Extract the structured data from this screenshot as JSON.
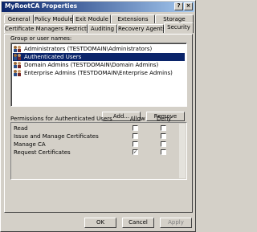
{
  "window": {
    "title": "MyRootCA Properties"
  },
  "tabs_row1": [
    "General",
    "Policy Module",
    "Exit Module",
    "Extensions",
    "Storage"
  ],
  "tabs_row2": [
    "Certificate Managers Restrictions",
    "Auditing",
    "Recovery Agents",
    "Security"
  ],
  "active_tab": "Security",
  "security": {
    "group_label": "Group or user names:",
    "users": [
      "Administrators (TESTDOMAIN\\Administrators)",
      "Authenticated Users",
      "Domain Admins (TESTDOMAIN\\Domain Admins)",
      "Enterprise Admins (TESTDOMAIN\\Enterprise Admins)"
    ],
    "selected_user": "Authenticated Users",
    "add_label": "Add...",
    "remove_label": "Remove",
    "permissions_label": "Permissions for Authenticated Users",
    "allow_label": "Allow",
    "deny_label": "Deny",
    "permissions": [
      {
        "name": "Read",
        "allow": false,
        "deny": false
      },
      {
        "name": "Issue and Manage Certificates",
        "allow": false,
        "deny": false
      },
      {
        "name": "Manage CA",
        "allow": false,
        "deny": false
      },
      {
        "name": "Request Certificates",
        "allow": true,
        "deny": false
      }
    ]
  },
  "footer": {
    "ok": "OK",
    "cancel": "Cancel",
    "apply": "Apply"
  }
}
